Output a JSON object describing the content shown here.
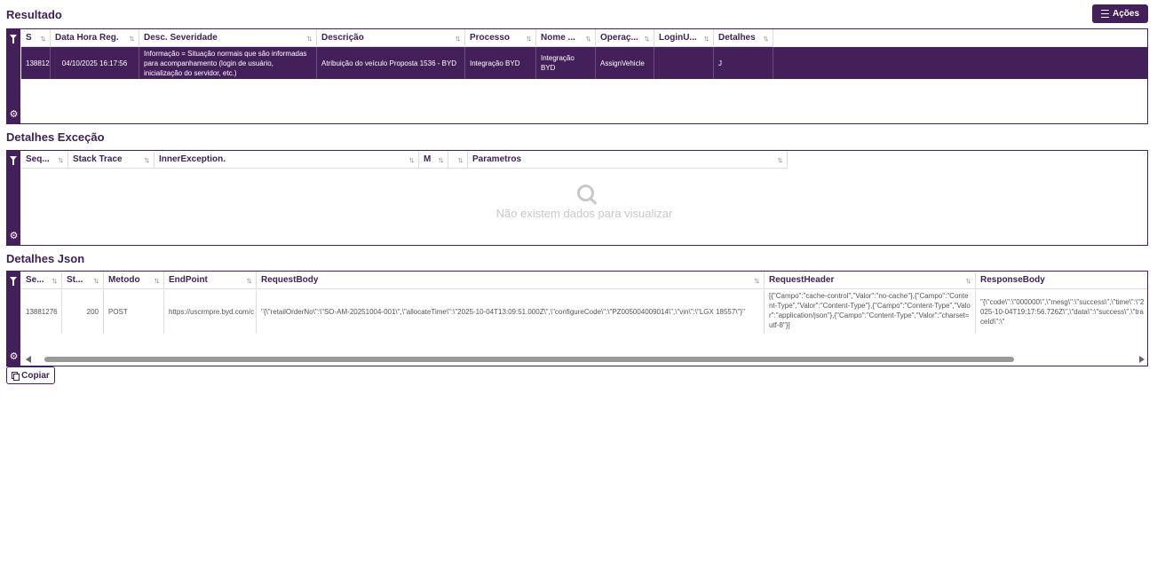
{
  "sections": {
    "resultado": "Resultado",
    "excecao": "Detalhes Exceção",
    "json": "Detalhes Json"
  },
  "actions_button": "Ações",
  "copy_button": "Copiar",
  "sort_icon": "↑↓",
  "resultado_table": {
    "headers": [
      "S",
      "Data Hora Reg.",
      "Desc. Severidade",
      "Descrição",
      "Processo",
      "Nome ...",
      "Operaç...",
      "LoginU...",
      "Detalhes"
    ],
    "row": {
      "seq": "138812",
      "datahora": "04/10/2025 16:17:56",
      "severidade": "Informação = Situação normais que são informadas para acompanhamento (login de usuário, inicialização do servidor, etc.)",
      "descricao": "Atribuição do veículo Proposta 1536 - BYD",
      "processo": "Integração BYD",
      "nome": "Integração BYD",
      "operacao": "AssignVehicle",
      "login": "",
      "detalhes": "J"
    }
  },
  "excecao_table": {
    "headers": [
      "Seq...",
      "Stack Trace",
      "InnerException.",
      "M",
      "",
      "Parametros"
    ],
    "empty_message": "Não existem dados para visualizar"
  },
  "json_table": {
    "headers": [
      "Se...",
      "St...",
      "Metodo",
      "EndPoint",
      "RequestBody",
      "RequestHeader",
      "ResponseBody"
    ],
    "row": {
      "seq": "13881276",
      "status": "200",
      "metodo": "POST",
      "endpoint": "https://uscrmpre.byd.com/c",
      "requestbody": "\"{\\\"retailOrderNo\\\":\\\"SO-AM-20251004-001\\\",\\\"allocateTime\\\":\\\"2025-10-04T13:09:51.000Z\\\",\\\"configureCode\\\":\\\"PZ005004009014\\\",\\\"vin\\\":\\\"LGX                    18557\\\"}\"",
      "requestheader": "[{\"Campo\":\"cache-control\",\"Valor\":\"no-cache\"},{\"Campo\":\"Content-Type\",\"Valor\":\"Content-Type\"},{\"Campo\":\"Content-Type\",\"Valor\":\"application/json\"},{\"Campo\":\"Content-Type\",\"Valor\":\"charset=utf-8\"}]",
      "responsebody": "\"{\\\"code\\\":\\\"000000\\\",\\\"mesg\\\":\\\"success\\\",\\\"time\\\":\\\"2025-10-04T19:17:56.726Z\\\",\\\"data\\\":\\\"success\\\",\\\"traceId\\\":\\\""
    }
  },
  "colors": {
    "accent": "#44205a",
    "title": "#3f2254"
  }
}
